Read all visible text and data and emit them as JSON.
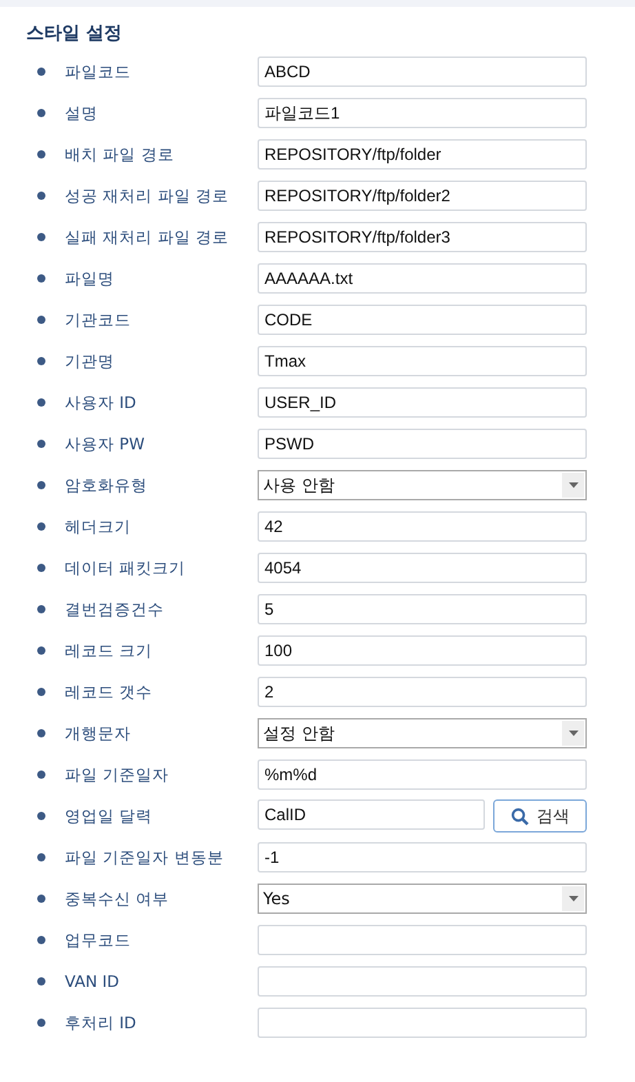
{
  "title": "스타일 설정",
  "fields": [
    {
      "label": "파일코드",
      "kind": "text",
      "value": "ABCD"
    },
    {
      "label": "설명",
      "kind": "text",
      "value": "파일코드1"
    },
    {
      "label": "배치 파일 경로",
      "kind": "text",
      "value": "REPOSITORY/ftp/folder"
    },
    {
      "label": "성공 재처리 파일 경로",
      "kind": "text",
      "value": "REPOSITORY/ftp/folder2"
    },
    {
      "label": "실패 재처리 파일 경로",
      "kind": "text",
      "value": "REPOSITORY/ftp/folder3"
    },
    {
      "label": "파일명",
      "kind": "text",
      "value": "AAAAAA.txt"
    },
    {
      "label": "기관코드",
      "kind": "text",
      "value": "CODE"
    },
    {
      "label": "기관명",
      "kind": "text",
      "value": "Tmax"
    },
    {
      "label": "사용자 ID",
      "kind": "text",
      "value": "USER_ID"
    },
    {
      "label": "사용자 PW",
      "kind": "text",
      "value": "PSWD"
    },
    {
      "label": "암호화유형",
      "kind": "select",
      "value": "사용 안함"
    },
    {
      "label": "헤더크기",
      "kind": "text",
      "value": "42"
    },
    {
      "label": "데이터 패킷크기",
      "kind": "text",
      "value": "4054"
    },
    {
      "label": "결번검증건수",
      "kind": "text",
      "value": "5"
    },
    {
      "label": "레코드 크기",
      "kind": "text",
      "value": "100"
    },
    {
      "label": "레코드 갯수",
      "kind": "text",
      "value": "2"
    },
    {
      "label": "개행문자",
      "kind": "select",
      "value": "설정 안함"
    },
    {
      "label": "파일 기준일자",
      "kind": "text",
      "value": "%m%d"
    },
    {
      "label": "영업일 달력",
      "kind": "search",
      "value": "CalID",
      "button": "검색"
    },
    {
      "label": "파일 기준일자 변동분",
      "kind": "text",
      "value": "-1"
    },
    {
      "label": "중복수신 여부",
      "kind": "select",
      "value": "Yes"
    },
    {
      "label": "업무코드",
      "kind": "text"
    },
    {
      "label": "VAN ID",
      "kind": "text"
    },
    {
      "label": "후처리 ID",
      "kind": "text"
    }
  ]
}
